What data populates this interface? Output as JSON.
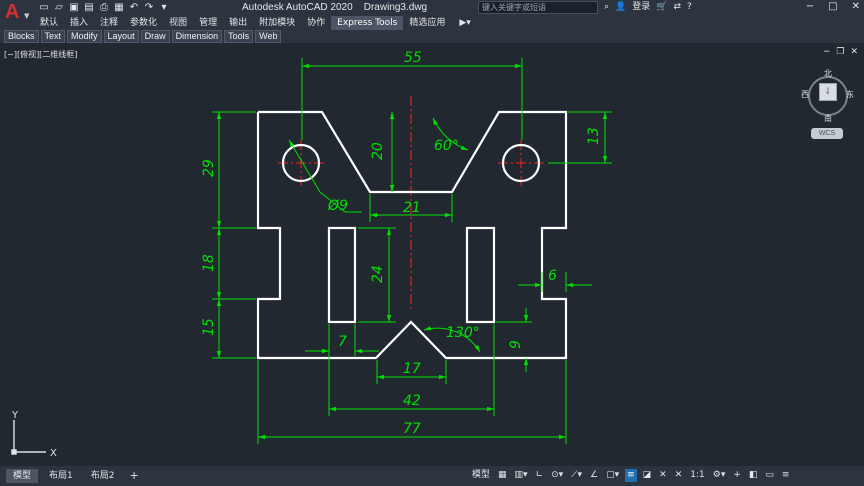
{
  "app": {
    "title": "Autodesk AutoCAD 2020    Drawing3.dwg",
    "logo_letter": "A",
    "search_placeholder": "键入关键字或短语",
    "login_label": "登录",
    "quick_access_icons": [
      "new-icon",
      "open-icon",
      "save-icon",
      "save-as-icon",
      "print-icon",
      "undo-icon",
      "redo-icon",
      "dropdown-icon"
    ]
  },
  "menu": {
    "items": [
      "默认",
      "插入",
      "注释",
      "参数化",
      "视图",
      "管理",
      "输出",
      "附加模块",
      "协作",
      "Express Tools",
      "精选应用"
    ],
    "active": "Express Tools"
  },
  "ribbon_tabs": [
    "Blocks",
    "Text",
    "Modify",
    "Layout",
    "Draw",
    "Dimension",
    "Tools",
    "Web"
  ],
  "viewport": {
    "label": "[−][俯视][二维线框]"
  },
  "viewcube": {
    "north": "北",
    "south": "南",
    "east": "东",
    "west": "西",
    "wcs": "WCS"
  },
  "dimensions": {
    "d55": "55",
    "d20": "20",
    "d60": "60°",
    "d13": "13",
    "d29": "29",
    "phi9": "Ø9",
    "d21": "21",
    "d18": "18",
    "d24": "24",
    "d6": "6",
    "d15": "15",
    "d7": "7",
    "d130": "130°",
    "d9": "9",
    "d17": "17",
    "d42": "42",
    "d77": "77"
  },
  "ucs": {
    "x_label": "X",
    "y_label": "Y"
  },
  "status": {
    "layout_tabs": [
      "模型",
      "布局1",
      "布局2"
    ],
    "active_tab": "模型",
    "model_label": "模型",
    "scale_label": "1:1"
  },
  "colors": {
    "background": "#212830",
    "object_lines": "#ffffff",
    "dimension_lines": "#00e000",
    "center_lines": "#ff2020",
    "chrome": "#2c3440"
  }
}
